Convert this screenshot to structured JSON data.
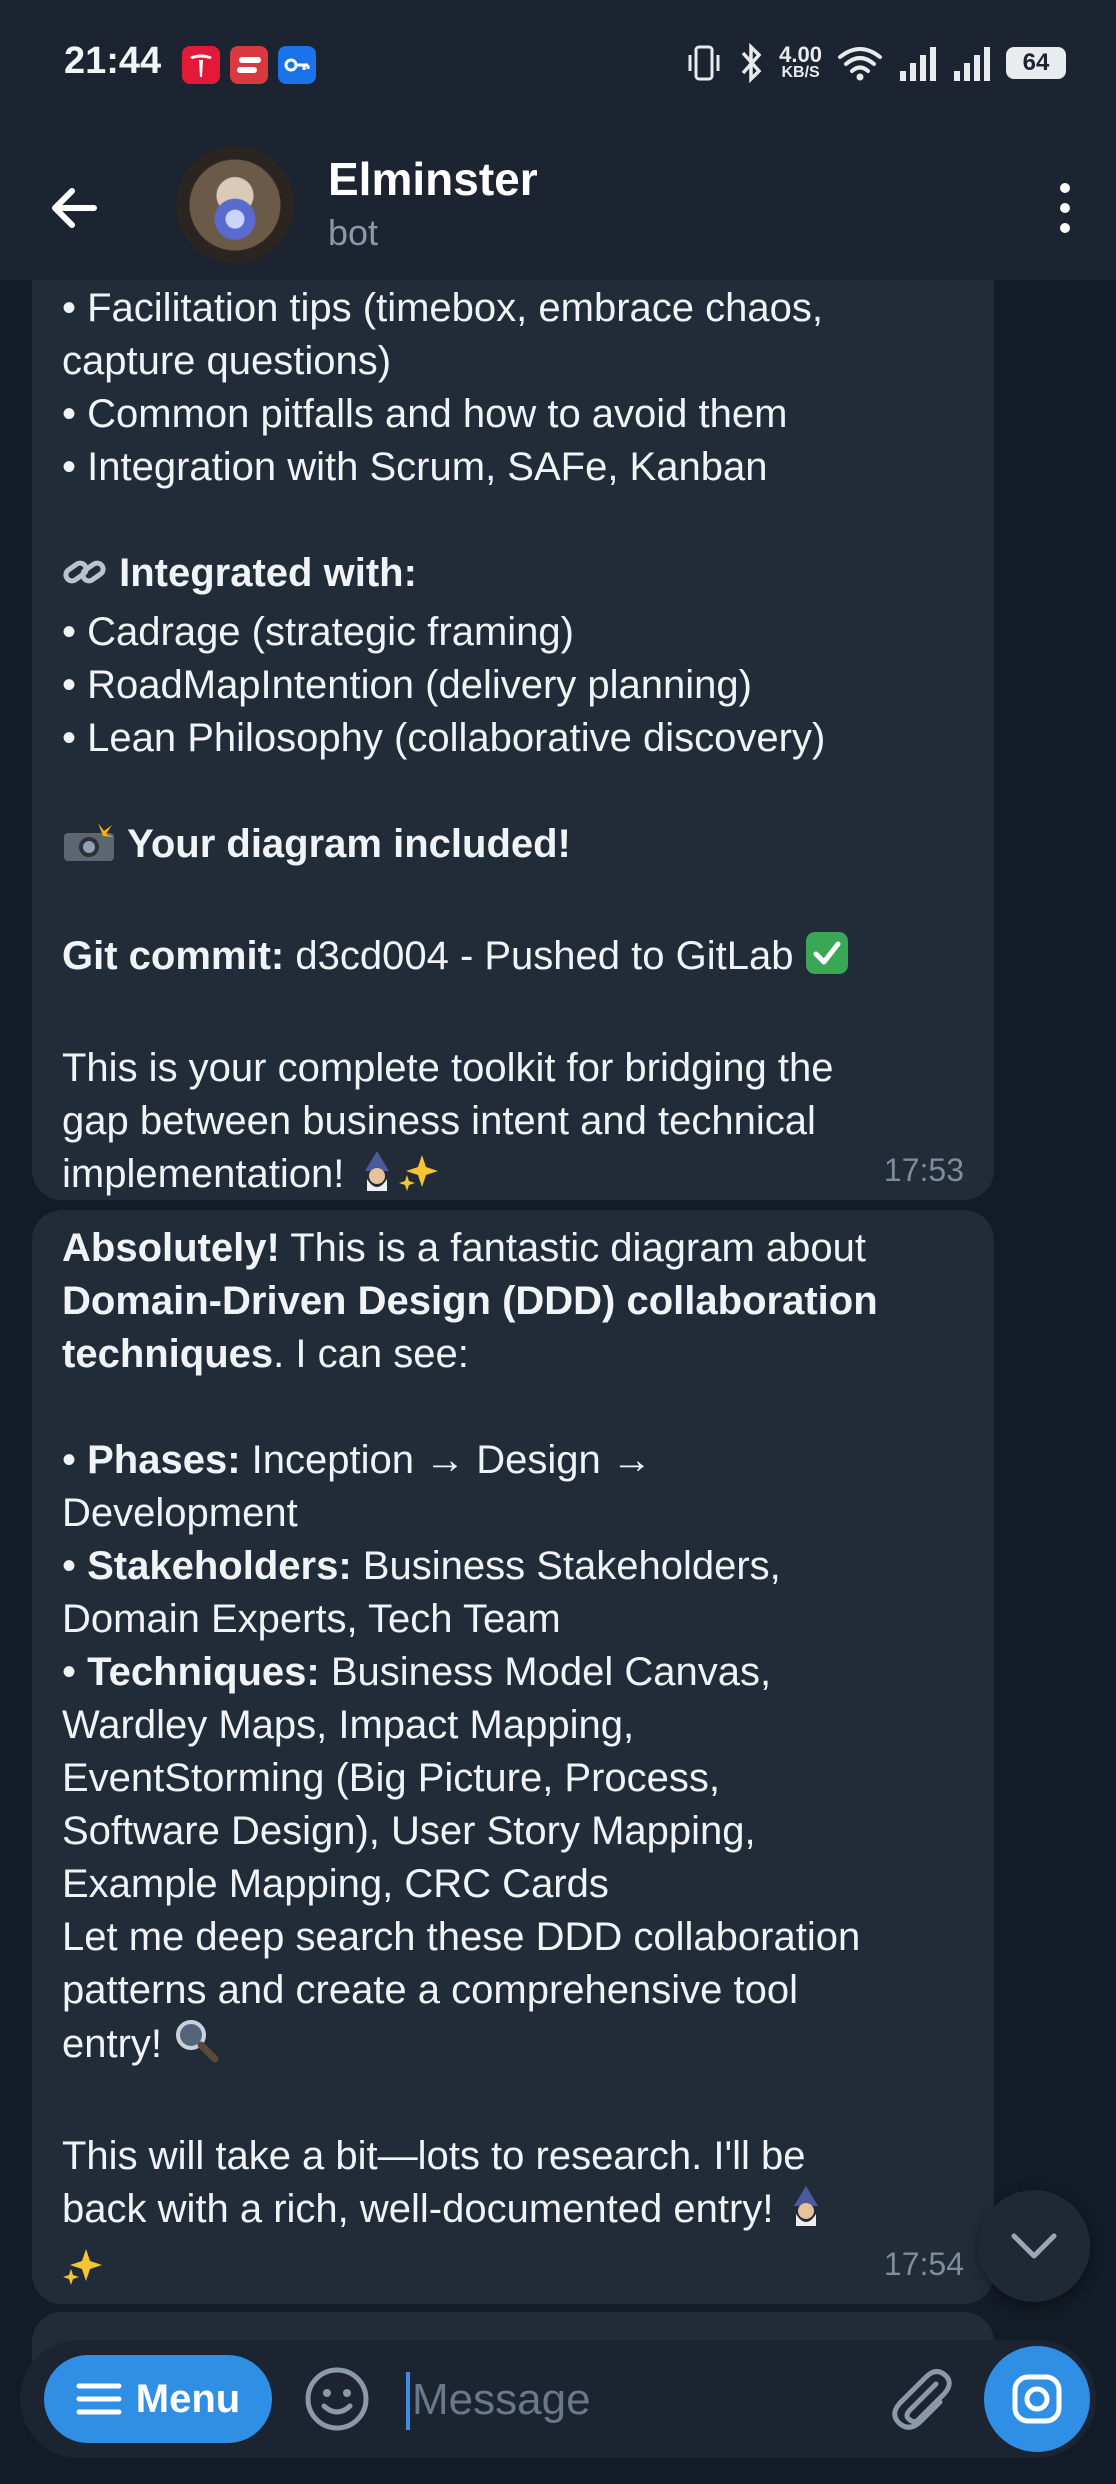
{
  "status_bar": {
    "time": "21:44",
    "notifications": [
      "tesla-icon",
      "expressvpn-icon",
      "key-icon"
    ],
    "net_speed_value": "4.00",
    "net_speed_unit": "KB/S",
    "battery": "64"
  },
  "header": {
    "title": "Elminster",
    "subtitle": "bot"
  },
  "messages": [
    {
      "lines": [
        "• Facilitation tips (timebox, embrace chaos,",
        "capture questions)",
        "• Common pitfalls and how to avoid them",
        "• Integration with Scrum, SAFe, Kanban",
        "",
        "Integrated with:",
        "• Cadrage (strategic framing)",
        "• RoadMapIntention (delivery planning)",
        "• Lean Philosophy (collaborative discovery)",
        "",
        "Your diagram included!",
        "",
        "Git commit:",
        " d3cd004 - Pushed to GitLab",
        "",
        "This is your complete toolkit for bridging the",
        "gap between business intent and technical",
        "implementation!"
      ],
      "time": "17:53"
    },
    {
      "lines": [
        "Absolutely!",
        " This is a fantastic diagram about",
        "Domain-Driven Design (DDD) collaboration",
        "techniques",
        ". I can see:",
        "",
        "• ",
        "Phases:",
        " Inception → Design →",
        "Development",
        "Stakeholders:",
        " Business Stakeholders,",
        "Domain Experts, Tech Team",
        "Techniques:",
        " Business Model Canvas,",
        "Wardley Maps, Impact Mapping,",
        "EventStorming (Big Picture, Process,",
        "Software Design), User Story Mapping,",
        "Example Mapping, CRC Cards",
        "Let me deep search these DDD collaboration",
        "patterns and create a comprehensive tool",
        "entry!",
        "",
        "This will take a bit—lots to research. I'll be",
        "back with a rich, well-documented entry!"
      ],
      "time": "17:54"
    }
  ],
  "composer": {
    "menu_label": "Menu",
    "placeholder": "Message"
  },
  "colors": {
    "accent": "#2f8fe5",
    "bubble": "#222c39",
    "background": "#121b26",
    "header": "#1b2430"
  }
}
